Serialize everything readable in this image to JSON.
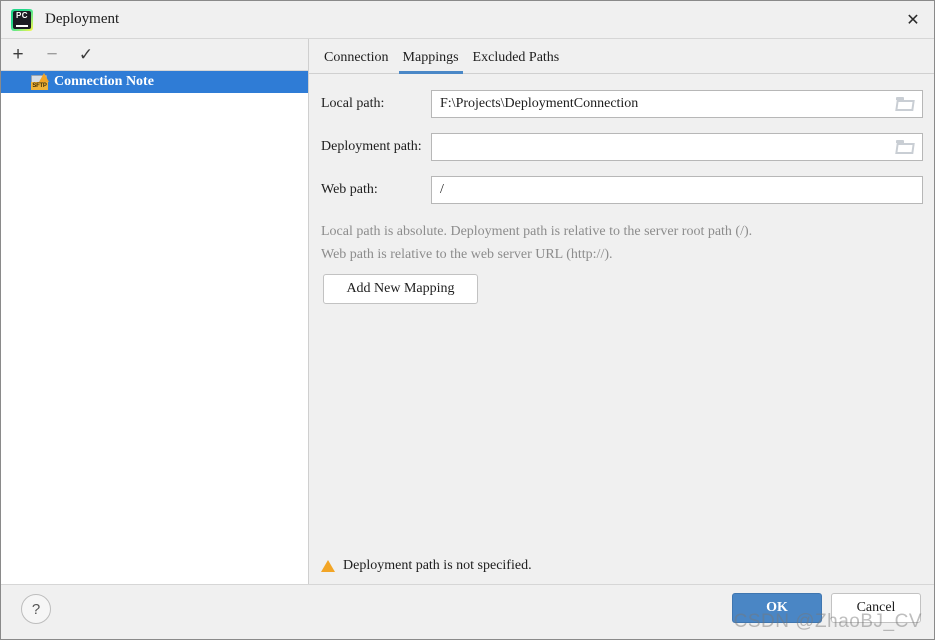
{
  "window": {
    "title": "Deployment",
    "app_icon": "pycharm-icon",
    "close_icon": "✕"
  },
  "left_panel": {
    "toolbar": [
      {
        "name": "add",
        "glyph": "+",
        "enabled": true
      },
      {
        "name": "remove",
        "glyph": "−",
        "enabled": false
      },
      {
        "name": "set-default",
        "glyph": "✓",
        "enabled": true
      }
    ],
    "tree": {
      "items": [
        {
          "label": "Connection Note",
          "icon": "sftp-warning-icon",
          "icon_label": "SFTP",
          "selected": true
        }
      ]
    }
  },
  "right_panel": {
    "tabs": [
      {
        "label": "Connection",
        "active": false
      },
      {
        "label": "Mappings",
        "active": true
      },
      {
        "label": "Excluded Paths",
        "active": false
      }
    ],
    "fields": [
      {
        "label": "Local path:",
        "value": "F:\\Projects\\DeploymentConnection",
        "placeholder": "",
        "browse_icon": "folder-icon",
        "has_browse": true
      },
      {
        "label": "Deployment path:",
        "value": "",
        "placeholder": "",
        "browse_icon": "folder-icon",
        "has_browse": true
      },
      {
        "label": "Web path:",
        "value": "/",
        "placeholder": "",
        "browse_icon": "",
        "has_browse": false
      }
    ],
    "hints": [
      "Local path is absolute. Deployment path is relative to the server root path (/).",
      "Web path is relative to the web server URL (http://)."
    ],
    "add_mapping_label": "Add New Mapping",
    "warning": {
      "icon": "warning-triangle-icon",
      "text": "Deployment path is not specified."
    }
  },
  "bottom_bar": {
    "help_label": "?",
    "ok_label": "OK",
    "cancel_label": "Cancel"
  },
  "watermark": "CSDN @ZhaoBJ_CV",
  "colors": {
    "accent_blue": "#4a86c5",
    "selection_blue": "#2f7cd6",
    "tab_underline": "#4a88c7",
    "warning_orange": "#f2a526",
    "dialog_bg": "#f0f0f0",
    "hint_gray": "#8c8c8c"
  }
}
